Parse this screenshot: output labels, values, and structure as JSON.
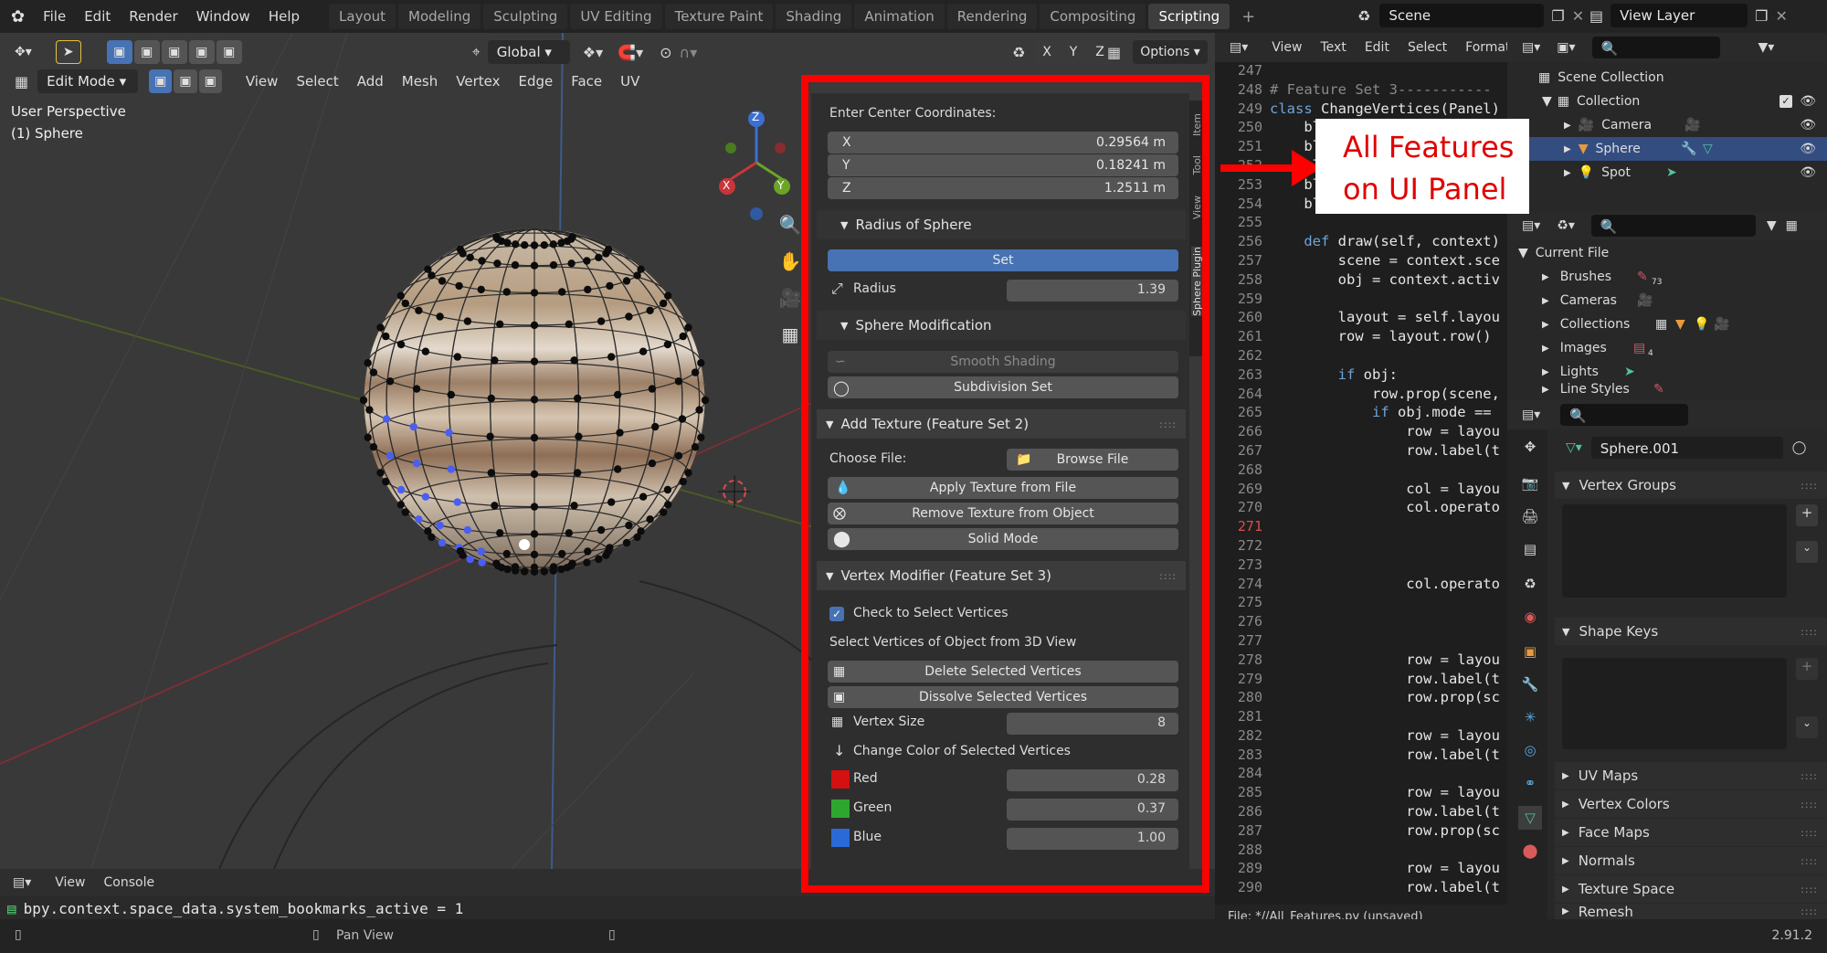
{
  "menubar": {
    "items": [
      "File",
      "Edit",
      "Render",
      "Window",
      "Help"
    ],
    "workspaces": [
      "Layout",
      "Modeling",
      "Sculpting",
      "UV Editing",
      "Texture Paint",
      "Shading",
      "Animation",
      "Rendering",
      "Compositing",
      "Scripting"
    ],
    "active_workspace": "Scripting",
    "add_tab": "+",
    "scene": "Scene",
    "view_layer": "View Layer"
  },
  "viewport": {
    "mode": "Edit Mode",
    "menus": [
      "View",
      "Select",
      "Add",
      "Mesh",
      "Vertex",
      "Edge",
      "Face",
      "UV"
    ],
    "orientation": "Global",
    "axes": [
      "X",
      "Y",
      "Z"
    ],
    "options_label": "Options",
    "overlay_title": "User Perspective",
    "overlay_object": "(1) Sphere",
    "gizmo": {
      "x": "X",
      "y": "Y",
      "z": "Z"
    }
  },
  "npanel": {
    "center_label": "Enter Center Coordinates:",
    "coords": [
      {
        "axis": "X",
        "value": "0.29564 m"
      },
      {
        "axis": "Y",
        "value": "0.18241 m"
      },
      {
        "axis": "Z",
        "value": "1.2511 m"
      }
    ],
    "radius_header": "Radius of Sphere",
    "set_label": "Set",
    "radius_label": "Radius",
    "radius_value": "1.39",
    "sphere_mod_header": "Sphere Modification",
    "smooth_label": "Smooth Shading",
    "subdiv_label": "Subdivision Set",
    "texture_header": "Add Texture (Feature Set 2)",
    "choose_file_label": "Choose File:",
    "browse_label": "Browse File",
    "apply_texture_label": "Apply Texture from File",
    "remove_texture_label": "Remove Texture from Object",
    "solid_mode_label": "Solid Mode",
    "vertex_header": "Vertex Modifier (Feature Set 3)",
    "check_label": "Check to Select Vertices",
    "select_hint": "Select Vertices of Object from 3D View",
    "delete_label": "Delete Selected Vertices",
    "dissolve_label": "Dissolve Selected Vertices",
    "vertex_size_label": "Vertex Size",
    "vertex_size_value": "8",
    "color_header": "Change Color of Selected Vertices",
    "colors": [
      {
        "name": "Red",
        "value": "0.28",
        "swatch": "#d41010"
      },
      {
        "name": "Green",
        "value": "0.37",
        "swatch": "#2fa62f"
      },
      {
        "name": "Blue",
        "value": "1.00",
        "swatch": "#2a6ad8"
      }
    ],
    "tabs": [
      "Item",
      "Tool",
      "View",
      "Sphere Plugin"
    ]
  },
  "editor": {
    "menus": [
      "View",
      "Text",
      "Edit",
      "Select",
      "Format"
    ],
    "line_numbers": [
      "247",
      "248",
      "249",
      "250",
      "251",
      "252",
      "253",
      "254",
      "255",
      "256",
      "257",
      "258",
      "259",
      "260",
      "261",
      "262",
      "263",
      "264",
      "265",
      "266",
      "267",
      "268",
      "269",
      "270",
      "271",
      "272",
      "273",
      "274",
      "275",
      "276",
      "277",
      "278",
      "279",
      "280",
      "281",
      "282",
      "283",
      "284",
      "285",
      "286",
      "287",
      "288",
      "289",
      "290"
    ],
    "current_line": "271",
    "code_lines": [
      "",
      "# Feature Set 3-----------",
      "class ChangeVertices(Panel)",
      "    bl_",
      "    bl_",
      "    bl_",
      "    bl_",
      "    bl_",
      "",
      "    def draw(self, context)",
      "        scene = context.sce",
      "        obj = context.activ",
      "",
      "        layout = self.layou",
      "        row = layout.row()",
      "",
      "        if obj:",
      "            row.prop(scene,",
      "            if obj.mode ==",
      "                row = layou",
      "                row.label(t",
      "",
      "                col = layou",
      "                col.operato",
      "",
      "",
      "",
      "                col.operato",
      "",
      "",
      "",
      "                row = layou",
      "                row.label(t",
      "                row.prop(sc",
      "",
      "                row = layou",
      "                row.label(t",
      "",
      "                row = layou",
      "                row.label(t",
      "                row.prop(sc",
      "",
      "                row = layou",
      "                row.label(t"
    ],
    "file_status": "File: *//All_Features.py (unsaved)"
  },
  "outliner": {
    "root": "Scene Collection",
    "collection": "Collection",
    "objects": [
      "Camera",
      "Sphere",
      "Spot"
    ],
    "selected": "Sphere"
  },
  "blend_file": {
    "root": "Current File",
    "items": [
      "Brushes",
      "Cameras",
      "Collections",
      "Images",
      "Lights",
      "Line Styles"
    ],
    "badges": {
      "Brushes": "73",
      "Images": "4"
    }
  },
  "properties": {
    "mesh_name": "Sphere.001",
    "sections": [
      "Vertex Groups",
      "Shape Keys",
      "UV Maps",
      "Vertex Colors",
      "Face Maps",
      "Normals",
      "Texture Space",
      "Remesh"
    ]
  },
  "console": {
    "menus": [
      "View",
      "Console"
    ],
    "output": "bpy.context.space_data.system_bookmarks_active = 1"
  },
  "statusbar": {
    "hint": "Pan View",
    "version": "2.91.2"
  },
  "annotation": {
    "line1": "All Features",
    "line2": "on UI Panel",
    "color": "#ff0000"
  }
}
